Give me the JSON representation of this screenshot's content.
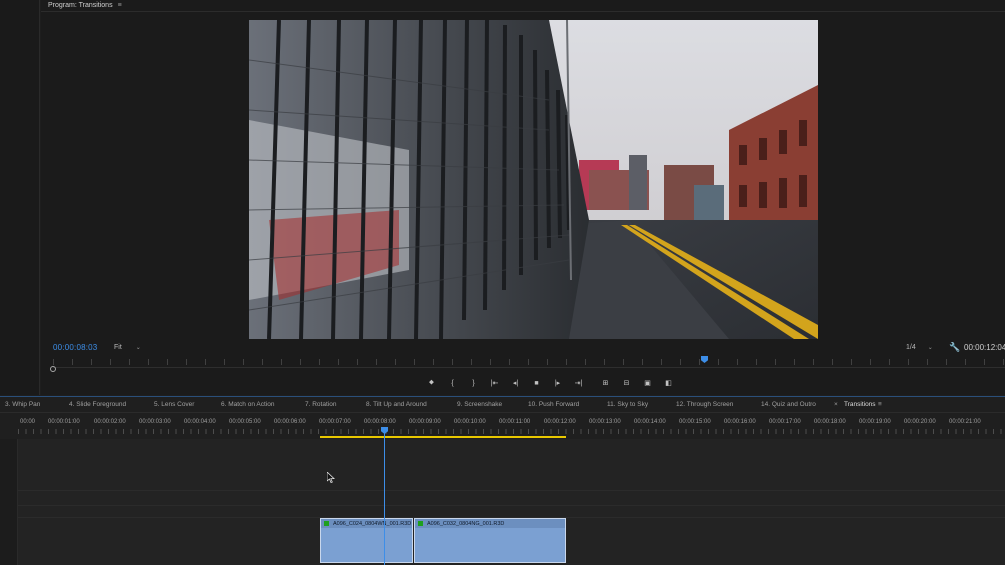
{
  "monitor": {
    "title": "Program: Transitions",
    "menu_icon": "hamburger-icon",
    "timecode_current": "00:00:08:03",
    "zoom": "Fit",
    "resolution": "1/4",
    "timecode_duration": "00:00:12:04",
    "transport": {
      "marker": "marker-icon",
      "in": "{",
      "out": "}",
      "go_in": "go-to-in-icon",
      "step_back": "step-back-icon",
      "stop": "stop-icon",
      "step_fwd": "step-forward-icon",
      "go_out": "go-to-out-icon",
      "lift": "lift-icon",
      "extract": "extract-icon",
      "export_frame": "camera-icon",
      "compare": "compare-icon"
    }
  },
  "timeline": {
    "tabs": [
      {
        "label": "3. Whip Pan"
      },
      {
        "label": "4. Slide Foreground"
      },
      {
        "label": "5. Lens Cover"
      },
      {
        "label": "6. Match on Action"
      },
      {
        "label": "7. Rotation"
      },
      {
        "label": "8. Tilt Up and Around"
      },
      {
        "label": "9. Screenshake"
      },
      {
        "label": "10. Push Forward"
      },
      {
        "label": "11. Sky to Sky"
      },
      {
        "label": "12. Through Screen"
      },
      {
        "label": "14. Quiz and Outro"
      },
      {
        "label": "Transitions"
      }
    ],
    "ruler": [
      "00:00",
      "00:00:01:00",
      "00:00:02:00",
      "00:00:03:00",
      "00:00:04:00",
      "00:00:05:00",
      "00:00:06:00",
      "00:00:07:00",
      "00:00:08:00",
      "00:00:09:00",
      "00:00:10:00",
      "00:00:11:00",
      "00:00:12:00",
      "00:00:13:00",
      "00:00:14:00",
      "00:00:15:00",
      "00:00:16:00",
      "00:00:17:00",
      "00:00:18:00",
      "00:00:19:00",
      "00:00:20:00",
      "00:00:21:00"
    ],
    "clips": [
      {
        "name": "A096_C024_0804WN_001.R3D"
      },
      {
        "name": "A096_C032_0804NG_001.R3D"
      }
    ],
    "colors": {
      "accent": "#3d8ee8",
      "clip": "#7ba0d2",
      "work_area": "#e9c800"
    }
  }
}
